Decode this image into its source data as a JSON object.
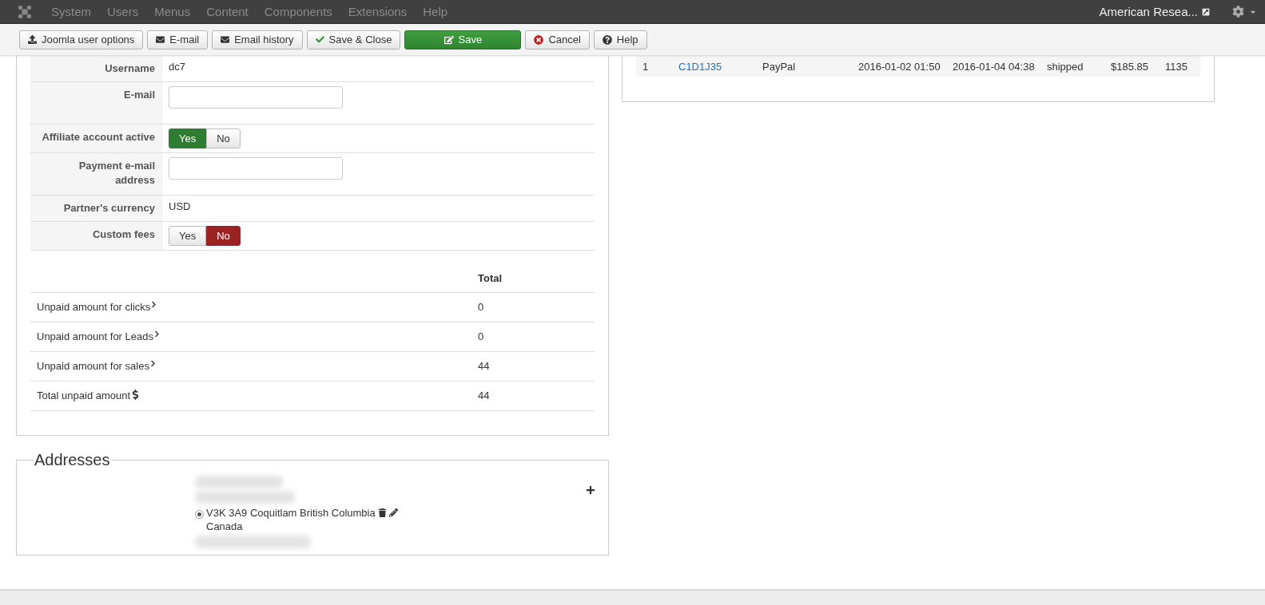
{
  "nav": {
    "menu": [
      {
        "label": "System"
      },
      {
        "label": "Users"
      },
      {
        "label": "Menus"
      },
      {
        "label": "Content"
      },
      {
        "label": "Components"
      },
      {
        "label": "Extensions"
      },
      {
        "label": "Help"
      }
    ],
    "site_link": "American Resea..."
  },
  "toolbar": [
    {
      "label": "Joomla user options",
      "kind": "upload"
    },
    {
      "label": "E-mail",
      "kind": "mail"
    },
    {
      "label": "Email history",
      "kind": "mail"
    },
    {
      "label": "Save & Close",
      "kind": "check"
    },
    {
      "label": "Save",
      "kind": "save"
    },
    {
      "label": "Cancel",
      "kind": "cancel"
    },
    {
      "label": "Help",
      "kind": "help"
    }
  ],
  "form": [
    {
      "kind": "text",
      "label": "Username",
      "value": "dc7"
    },
    {
      "kind": "input",
      "label": "E-mail"
    },
    {
      "kind": "toggle",
      "label": "Affiliate account active",
      "options": [
        {
          "label": "Yes",
          "kind": "yes",
          "selected": true
        },
        {
          "label": "No",
          "kind": "no",
          "selected": false
        }
      ]
    },
    {
      "kind": "input",
      "label": "Payment e-mail address"
    },
    {
      "kind": "text",
      "label": "Partner's currency",
      "value": "USD"
    },
    {
      "kind": "toggle",
      "label": "Custom fees",
      "options": [
        {
          "label": "Yes",
          "kind": "yes",
          "selected": false
        },
        {
          "label": "No",
          "kind": "no",
          "selected": true
        }
      ]
    }
  ],
  "totals": {
    "header": "Total",
    "rows": [
      {
        "label": "Unpaid amount for clicks",
        "kind": "chevron",
        "value": "0"
      },
      {
        "label": "Unpaid amount for Leads",
        "kind": "chevron",
        "value": "0"
      },
      {
        "label": "Unpaid amount for sales",
        "kind": "chevron",
        "value": "44"
      },
      {
        "label": "Total unpaid amount",
        "kind": "dollar",
        "value": "44"
      }
    ]
  },
  "addresses": {
    "legend": "Addresses",
    "items": [
      {
        "selected": true,
        "line": "V3K 3A9 Coquitlam British Columbia",
        "country": "Canada"
      }
    ]
  },
  "orders": {
    "rows": [
      {
        "cells": [
          "1",
          "C1D1J35",
          "PayPal",
          "2016-01-02 01:50",
          "2016-01-04 04:38",
          "shipped",
          "$185.85",
          "1135"
        ]
      }
    ]
  }
}
